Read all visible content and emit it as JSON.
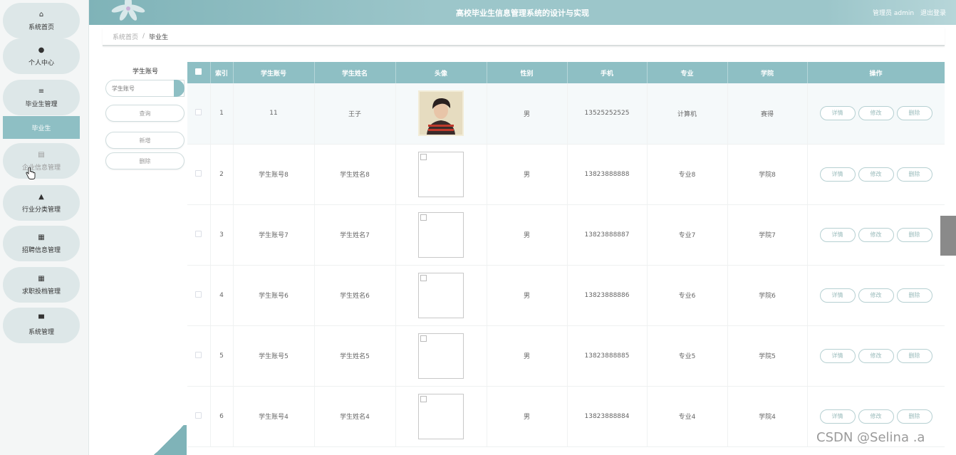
{
  "header": {
    "title": "高校毕业生信息管理系统的设计与实现",
    "user_role": "管理员 admin",
    "logout": "退出登录"
  },
  "sidebar": {
    "items": [
      {
        "label": "系统首页",
        "icon": "home-icon",
        "glyph": "⌂"
      },
      {
        "label": "个人中心",
        "icon": "user-icon",
        "glyph": "●"
      },
      {
        "label": "毕业生管理",
        "icon": "list-icon",
        "glyph": "≡"
      },
      {
        "label": "企业信息管理",
        "icon": "doc-icon",
        "glyph": "▤"
      },
      {
        "label": "行业分类管理",
        "icon": "thumb-icon",
        "glyph": "▲"
      },
      {
        "label": "招聘信息管理",
        "icon": "grid-icon",
        "glyph": "▦"
      },
      {
        "label": "求职投档管理",
        "icon": "grid-icon",
        "glyph": "▦"
      },
      {
        "label": "系统管理",
        "icon": "monitor-icon",
        "glyph": "▀"
      }
    ],
    "sub_item": "毕业生"
  },
  "breadcrumb": {
    "home": "系统首页",
    "sep": "/",
    "current": "毕业生"
  },
  "search": {
    "label": "学生账号",
    "placeholder": "学生账号",
    "query_button": "查询",
    "add_button": "新增",
    "delete_button": "删除"
  },
  "table": {
    "headers": [
      "索引",
      "学生账号",
      "学生姓名",
      "头像",
      "性别",
      "手机",
      "专业",
      "学院",
      "操作"
    ],
    "actions": {
      "detail": "详情",
      "edit": "修改",
      "delete": "删除"
    },
    "rows": [
      {
        "index": "1",
        "account": "11",
        "name": "王子",
        "gender": "男",
        "phone": "13525252525",
        "major": "计算机",
        "college": "赛得",
        "avatar": "photo"
      },
      {
        "index": "2",
        "account": "学生账号8",
        "name": "学生姓名8",
        "gender": "男",
        "phone": "13823888888",
        "major": "专业8",
        "college": "学院8",
        "avatar": "broken"
      },
      {
        "index": "3",
        "account": "学生账号7",
        "name": "学生姓名7",
        "gender": "男",
        "phone": "13823888887",
        "major": "专业7",
        "college": "学院7",
        "avatar": "broken"
      },
      {
        "index": "4",
        "account": "学生账号6",
        "name": "学生姓名6",
        "gender": "男",
        "phone": "13823888886",
        "major": "专业6",
        "college": "学院6",
        "avatar": "broken"
      },
      {
        "index": "5",
        "account": "学生账号5",
        "name": "学生姓名5",
        "gender": "男",
        "phone": "13823888885",
        "major": "专业5",
        "college": "学院5",
        "avatar": "broken"
      },
      {
        "index": "6",
        "account": "学生账号4",
        "name": "学生姓名4",
        "gender": "男",
        "phone": "13823888884",
        "major": "专业4",
        "college": "学院4",
        "avatar": "broken"
      }
    ]
  },
  "watermark": "CSDN @Selina .a",
  "colors": {
    "accent": "#8ebfc4",
    "header": "#9cc6ca",
    "sidebar_item": "#dde7e8"
  }
}
